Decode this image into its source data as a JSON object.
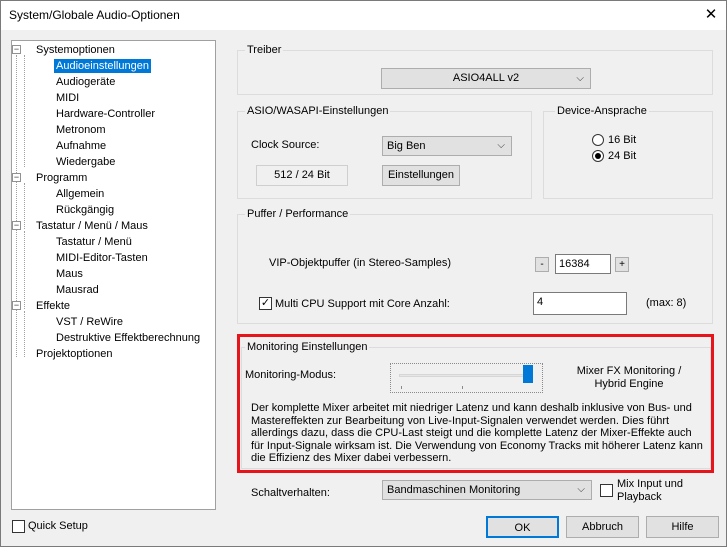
{
  "window": {
    "title": "System/Globale Audio-Optionen"
  },
  "tree": {
    "items": [
      {
        "label": "Systemoptionen"
      },
      {
        "label": "Audioeinstellungen"
      },
      {
        "label": "Audiogeräte"
      },
      {
        "label": "MIDI"
      },
      {
        "label": "Hardware-Controller"
      },
      {
        "label": "Metronom"
      },
      {
        "label": "Aufnahme"
      },
      {
        "label": "Wiedergabe"
      },
      {
        "label": "Programm"
      },
      {
        "label": "Allgemein"
      },
      {
        "label": "Rückgängig"
      },
      {
        "label": "Tastatur / Menü / Maus"
      },
      {
        "label": "Tastatur / Menü"
      },
      {
        "label": "MIDI-Editor-Tasten"
      },
      {
        "label": "Maus"
      },
      {
        "label": "Mausrad"
      },
      {
        "label": "Effekte"
      },
      {
        "label": "VST / ReWire"
      },
      {
        "label": "Destruktive Effektberechnung"
      },
      {
        "label": "Projektoptionen"
      }
    ],
    "selected": "Audioeinstellungen",
    "expand_symbol": "−"
  },
  "treiber": {
    "label": "Treiber",
    "value": "ASIO4ALL v2"
  },
  "asio": {
    "label": "ASIO/WASAPI-Einstellungen",
    "clock_label": "Clock Source:",
    "clock_value": "Big Ben",
    "buffer_info": "512 / 24 Bit",
    "settings_button": "Einstellungen"
  },
  "device": {
    "label": "Device-Ansprache",
    "option_16": "16 Bit",
    "option_24": "24 Bit",
    "selected": "24 Bit"
  },
  "puffer": {
    "label": "Puffer / Performance",
    "vip_label": "VIP-Objektpuffer (in Stereo-Samples)",
    "minus": "-",
    "vip_value": "16384",
    "plus": "+",
    "multicpu_label": "Multi CPU Support mit Core Anzahl:",
    "multicpu_checked": true,
    "cores_value": "4",
    "max_label": "(max: 8)"
  },
  "monitoring": {
    "label": "Monitoring Einstellungen",
    "mode_label": "Monitoring-Modus:",
    "slider_level": 1.0,
    "mode_value_line1": "Mixer FX Monitoring /",
    "mode_value_line2": "Hybrid Engine",
    "description": "Der komplette Mixer arbeitet mit niedriger Latenz und kann deshalb inklusive von Bus- und Mastereffekten zur Bearbeitung von Live-Input-Signalen verwendet werden. Dies führt allerdings dazu, dass die CPU-Last steigt und die komplette Latenz der Mixer-Effekte auch für Input-Signale wirksam ist. Die Verwendung von Economy Tracks mit höherer Latenz kann die Effizienz des Mixer dabei verbessern."
  },
  "schalt": {
    "label": "Schaltverhalten:",
    "value": "Bandmaschinen Monitoring",
    "mix_input_line1": "Mix Input und",
    "mix_input_line2": "Playback",
    "mix_input_checked": false
  },
  "footer": {
    "quick_setup": "Quick Setup",
    "quick_setup_checked": false,
    "ok": "OK",
    "cancel": "Abbruch",
    "help": "Hilfe"
  },
  "colors": {
    "highlight": "#e8141c",
    "selection": "#0078d7"
  }
}
